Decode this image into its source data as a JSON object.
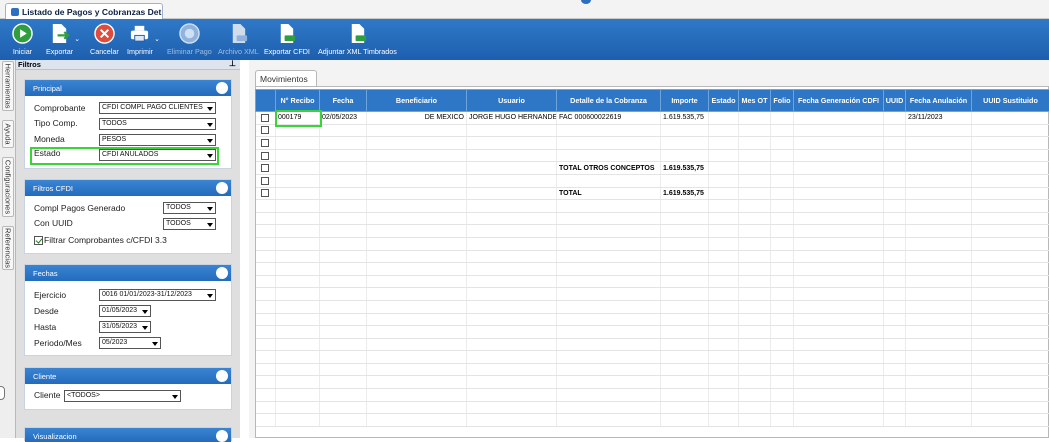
{
  "window": {
    "doc_tab_title": "Listado de Pagos y Cobranzas Det..."
  },
  "toolbar": {
    "iniciar": "Iniciar",
    "exportar": "Exportar",
    "cancelar": "Cancelar",
    "imprimir": "Imprimir",
    "eliminar_pago": "Eliminar Pago",
    "archivo_xml": "Archivo XML",
    "exportar_cfdi": "Exportar CFDI",
    "adjuntar_xml": "Adjuntar XML Timbrados"
  },
  "side_tabs": {
    "herramientas": "Herramientas",
    "ayuda": "Ayuda",
    "configuraciones": "Configuraciones",
    "referencias": "Referencias"
  },
  "filters": {
    "title": "Filtros",
    "principal": {
      "title": "Principal",
      "comprobante_label": "Comprobante",
      "comprobante_value": "CFDI COMPL PAGO CLIENTES",
      "tipo_label": "Tipo Comp.",
      "tipo_value": "TODOS",
      "moneda_label": "Moneda",
      "moneda_value": "PESOS",
      "estado_label": "Estado",
      "estado_value": "CFDI ANULADOS"
    },
    "cfdi": {
      "title": "Filtros CFDI",
      "compl_label": "Compl Pagos Generado",
      "compl_value": "TODOS",
      "uuid_label": "Con UUID",
      "uuid_value": "TODOS",
      "filtrar_label": "Filtrar Comprobantes c/CFDI  3.3",
      "filtrar_checked": true
    },
    "fechas": {
      "title": "Fechas",
      "ejercicio_label": "Ejercicio",
      "ejercicio_value": "0016 01/01/2023-31/12/2023",
      "desde_label": "Desde",
      "desde_value": "01/05/2023",
      "hasta_label": "Hasta",
      "hasta_value": "31/05/2023",
      "periodo_label": "Periodo/Mes",
      "periodo_value": "05/2023"
    },
    "cliente": {
      "title": "Cliente",
      "cliente_label": "Cliente",
      "cliente_value": "<TODOS>"
    },
    "visualizacion": {
      "title": "Visualizacion"
    }
  },
  "content": {
    "tab_label": "Movimientos",
    "columns": [
      "",
      "N° Recibo",
      "Fecha",
      "Beneficiario",
      "Usuario",
      "Detalle de la Cobranza",
      "Importe",
      "Estado",
      "Mes OT",
      "Folio",
      "Fecha Generación CDFI",
      "UUID",
      "Fecha Anulación",
      "UUID Sustituido"
    ],
    "rows": [
      {
        "check": true,
        "recibo": "000179",
        "fecha": "02/05/2023",
        "beneficiario": "DE MEXICO",
        "usuario": "JORGE HUGO HERNANDEZ",
        "detalle": "FAC 000600022619",
        "importe": "1.619.535,75",
        "estado": "",
        "mes_ot": "",
        "folio": "",
        "fecha_gen": "",
        "uuid": "",
        "fecha_anul": "23/11/2023",
        "uuid_sust": ""
      },
      {
        "check": true,
        "recibo": "",
        "fecha": "",
        "beneficiario": "",
        "usuario": "",
        "detalle": "",
        "importe": "",
        "estado": "",
        "mes_ot": "",
        "folio": "",
        "fecha_gen": "",
        "uuid": "",
        "fecha_anul": "",
        "uuid_sust": ""
      },
      {
        "check": true,
        "recibo": "",
        "fecha": "",
        "beneficiario": "",
        "usuario": "",
        "detalle": "",
        "importe": "",
        "estado": "",
        "mes_ot": "",
        "folio": "",
        "fecha_gen": "",
        "uuid": "",
        "fecha_anul": "",
        "uuid_sust": ""
      },
      {
        "check": true,
        "recibo": "",
        "fecha": "",
        "beneficiario": "",
        "usuario": "",
        "detalle": "",
        "importe": "",
        "estado": "",
        "mes_ot": "",
        "folio": "",
        "fecha_gen": "",
        "uuid": "",
        "fecha_anul": "",
        "uuid_sust": ""
      },
      {
        "check": true,
        "recibo": "",
        "fecha": "",
        "beneficiario": "",
        "usuario": "",
        "detalle": "TOTAL OTROS CONCEPTOS",
        "importe": "1.619.535,75",
        "estado": "",
        "mes_ot": "",
        "folio": "",
        "fecha_gen": "",
        "uuid": "",
        "fecha_anul": "",
        "uuid_sust": "",
        "bold": true
      },
      {
        "check": true,
        "recibo": "",
        "fecha": "",
        "beneficiario": "",
        "usuario": "",
        "detalle": "",
        "importe": "",
        "estado": "",
        "mes_ot": "",
        "folio": "",
        "fecha_gen": "",
        "uuid": "",
        "fecha_anul": "",
        "uuid_sust": ""
      },
      {
        "check": true,
        "recibo": "",
        "fecha": "",
        "beneficiario": "",
        "usuario": "",
        "detalle": "TOTAL",
        "importe": "1.619.535,75",
        "estado": "",
        "mes_ot": "",
        "folio": "",
        "fecha_gen": "",
        "uuid": "",
        "fecha_anul": "",
        "uuid_sust": "",
        "bold": true
      }
    ],
    "empty_rows": 18
  }
}
